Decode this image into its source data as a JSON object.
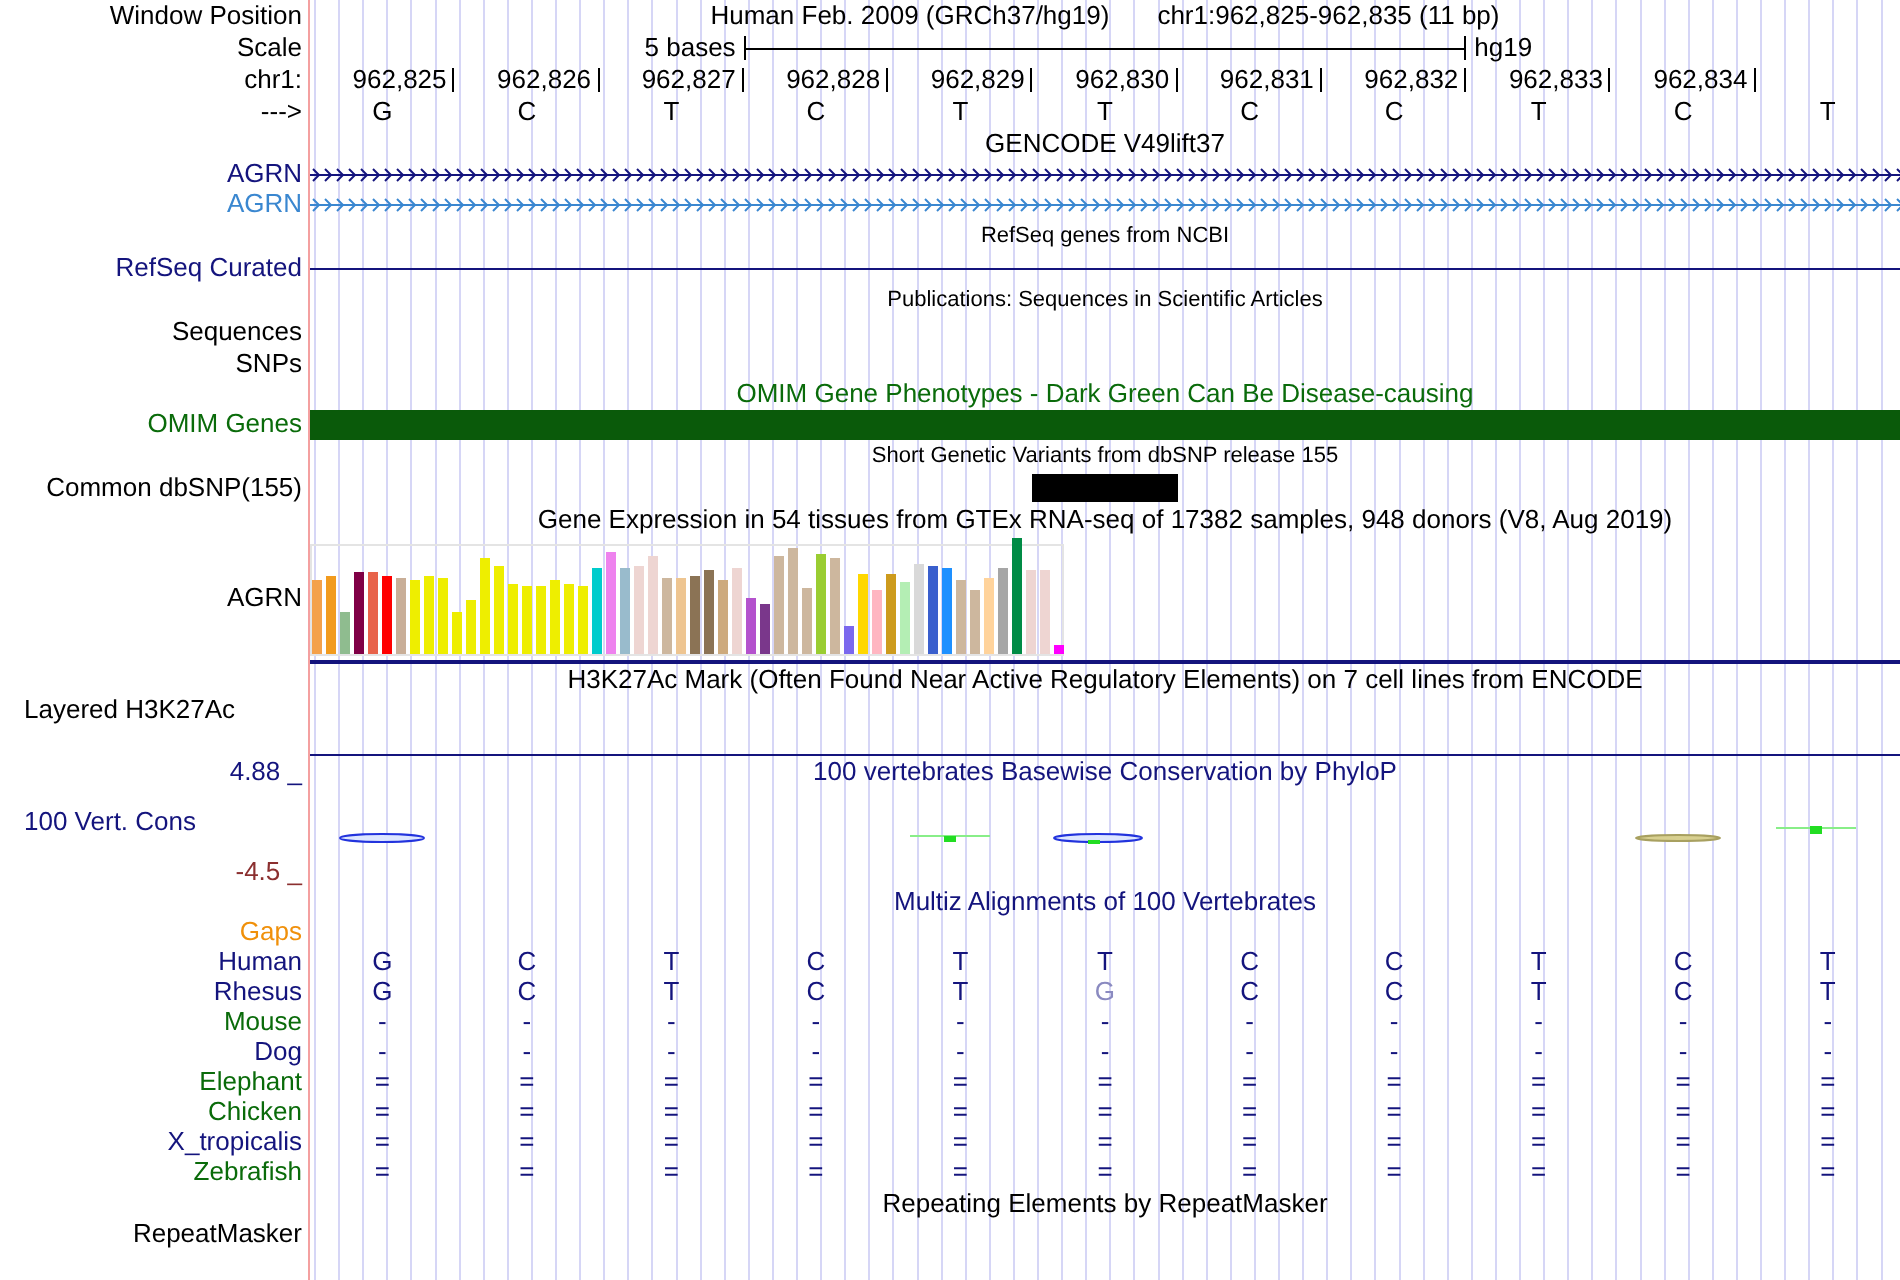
{
  "header": {
    "label": "Window Position",
    "title": "Human Feb. 2009 (GRCh37/hg19)",
    "position": "chr1:962,825-962,835 (11 bp)"
  },
  "scale": {
    "label": "Scale",
    "bar_label": "5 bases",
    "assembly": "hg19"
  },
  "ruler": {
    "label": "chr1:",
    "positions": [
      "962,825",
      "962,826",
      "962,827",
      "962,828",
      "962,829",
      "962,830",
      "962,831",
      "962,832",
      "962,833",
      "962,834"
    ]
  },
  "sequence": {
    "label": "--->",
    "bases": [
      "G",
      "C",
      "T",
      "C",
      "T",
      "T",
      "C",
      "C",
      "T",
      "C",
      "T"
    ]
  },
  "tracks": [
    {
      "kind": "gene",
      "title": "GENCODE V49lift37",
      "genes": [
        {
          "name": "AGRN",
          "color": "#14147d"
        },
        {
          "name": "AGRN",
          "color": "#3a87d0"
        }
      ]
    },
    {
      "kind": "line",
      "title": "RefSeq genes from NCBI",
      "label": "RefSeq Curated"
    },
    {
      "kind": "empty",
      "title": "Publications: Sequences in Scientific Articles",
      "labels": [
        "Sequences",
        "SNPs"
      ]
    },
    {
      "kind": "bar",
      "title": "OMIM Gene Phenotypes - Dark Green Can Be Disease-causing",
      "label": "OMIM Genes"
    },
    {
      "kind": "snp",
      "title": "Short Genetic Variants from dbSNP release 155",
      "label": "Common dbSNP(155)"
    },
    {
      "kind": "expression",
      "title": "Gene Expression in 54 tissues from GTEx RNA-seq of 17382 samples, 948 donors (V8, Aug 2019)",
      "label": "AGRN"
    },
    {
      "kind": "signal",
      "title": "H3K27Ac Mark (Often Found Near Active Regulatory Elements) on 7 cell lines from ENCODE",
      "label": "Layered H3K27Ac"
    },
    {
      "kind": "wiggle",
      "title": "100 vertebrates Basewise Conservation by PhyloP",
      "label": "100 Vert. Cons",
      "max": "4.88 _",
      "min": "-4.5 _"
    },
    {
      "kind": "alignment",
      "title": "Multiz Alignments of 100 Vertebrates",
      "gaps_label": "Gaps",
      "species": [
        {
          "name": "Human",
          "color": "#14147d",
          "bases": [
            {
              "b": "G",
              "differs": false
            },
            {
              "b": "C",
              "differs": false
            },
            {
              "b": "T",
              "differs": false
            },
            {
              "b": "C",
              "differs": false
            },
            {
              "b": "T",
              "differs": false
            },
            {
              "b": "T",
              "differs": false
            },
            {
              "b": "C",
              "differs": false
            },
            {
              "b": "C",
              "differs": false
            },
            {
              "b": "T",
              "differs": false
            },
            {
              "b": "C",
              "differs": false
            },
            {
              "b": "T",
              "differs": false
            }
          ]
        },
        {
          "name": "Rhesus",
          "color": "#14147d",
          "bases": [
            {
              "b": "G",
              "differs": false
            },
            {
              "b": "C",
              "differs": false
            },
            {
              "b": "T",
              "differs": false
            },
            {
              "b": "C",
              "differs": false
            },
            {
              "b": "T",
              "differs": false
            },
            {
              "b": "G",
              "differs": true
            },
            {
              "b": "C",
              "differs": false
            },
            {
              "b": "C",
              "differs": false
            },
            {
              "b": "T",
              "differs": false
            },
            {
              "b": "C",
              "differs": false
            },
            {
              "b": "T",
              "differs": false
            }
          ]
        },
        {
          "name": "Mouse",
          "color": "#0a6b0a",
          "bases": [
            {
              "b": "-",
              "differs": false
            },
            {
              "b": "-",
              "differs": false
            },
            {
              "b": "-",
              "differs": false
            },
            {
              "b": "-",
              "differs": false
            },
            {
              "b": "-",
              "differs": false
            },
            {
              "b": "-",
              "differs": false
            },
            {
              "b": "-",
              "differs": false
            },
            {
              "b": "-",
              "differs": false
            },
            {
              "b": "-",
              "differs": false
            },
            {
              "b": "-",
              "differs": false
            },
            {
              "b": "-",
              "differs": false
            }
          ]
        },
        {
          "name": "Dog",
          "color": "#14147d",
          "bases": [
            {
              "b": "-",
              "differs": false
            },
            {
              "b": "-",
              "differs": false
            },
            {
              "b": "-",
              "differs": false
            },
            {
              "b": "-",
              "differs": false
            },
            {
              "b": "-",
              "differs": false
            },
            {
              "b": "-",
              "differs": false
            },
            {
              "b": "-",
              "differs": false
            },
            {
              "b": "-",
              "differs": false
            },
            {
              "b": "-",
              "differs": false
            },
            {
              "b": "-",
              "differs": false
            },
            {
              "b": "-",
              "differs": false
            }
          ]
        },
        {
          "name": "Elephant",
          "color": "#0a6b0a",
          "bases": [
            {
              "b": "=",
              "differs": false
            },
            {
              "b": "=",
              "differs": false
            },
            {
              "b": "=",
              "differs": false
            },
            {
              "b": "=",
              "differs": false
            },
            {
              "b": "=",
              "differs": false
            },
            {
              "b": "=",
              "differs": false
            },
            {
              "b": "=",
              "differs": false
            },
            {
              "b": "=",
              "differs": false
            },
            {
              "b": "=",
              "differs": false
            },
            {
              "b": "=",
              "differs": false
            },
            {
              "b": "=",
              "differs": false
            }
          ]
        },
        {
          "name": "Chicken",
          "color": "#0a6b0a",
          "bases": [
            {
              "b": "=",
              "differs": false
            },
            {
              "b": "=",
              "differs": false
            },
            {
              "b": "=",
              "differs": false
            },
            {
              "b": "=",
              "differs": false
            },
            {
              "b": "=",
              "differs": false
            },
            {
              "b": "=",
              "differs": false
            },
            {
              "b": "=",
              "differs": false
            },
            {
              "b": "=",
              "differs": false
            },
            {
              "b": "=",
              "differs": false
            },
            {
              "b": "=",
              "differs": false
            },
            {
              "b": "=",
              "differs": false
            }
          ]
        },
        {
          "name": "X_tropicalis",
          "color": "#14147d",
          "bases": [
            {
              "b": "=",
              "differs": false
            },
            {
              "b": "=",
              "differs": false
            },
            {
              "b": "=",
              "differs": false
            },
            {
              "b": "=",
              "differs": false
            },
            {
              "b": "=",
              "differs": false
            },
            {
              "b": "=",
              "differs": false
            },
            {
              "b": "=",
              "differs": false
            },
            {
              "b": "=",
              "differs": false
            },
            {
              "b": "=",
              "differs": false
            },
            {
              "b": "=",
              "differs": false
            },
            {
              "b": "=",
              "differs": false
            }
          ]
        },
        {
          "name": "Zebrafish",
          "color": "#0a6b0a",
          "bases": [
            {
              "b": "=",
              "differs": false
            },
            {
              "b": "=",
              "differs": false
            },
            {
              "b": "=",
              "differs": false
            },
            {
              "b": "=",
              "differs": false
            },
            {
              "b": "=",
              "differs": false
            },
            {
              "b": "=",
              "differs": false
            },
            {
              "b": "=",
              "differs": false
            },
            {
              "b": "=",
              "differs": false
            },
            {
              "b": "=",
              "differs": false
            },
            {
              "b": "=",
              "differs": false
            },
            {
              "b": "=",
              "differs": false
            }
          ]
        }
      ]
    },
    {
      "kind": "repeat",
      "title": "Repeating Elements by RepeatMasker",
      "label": "RepeatMasker"
    }
  ]
}
